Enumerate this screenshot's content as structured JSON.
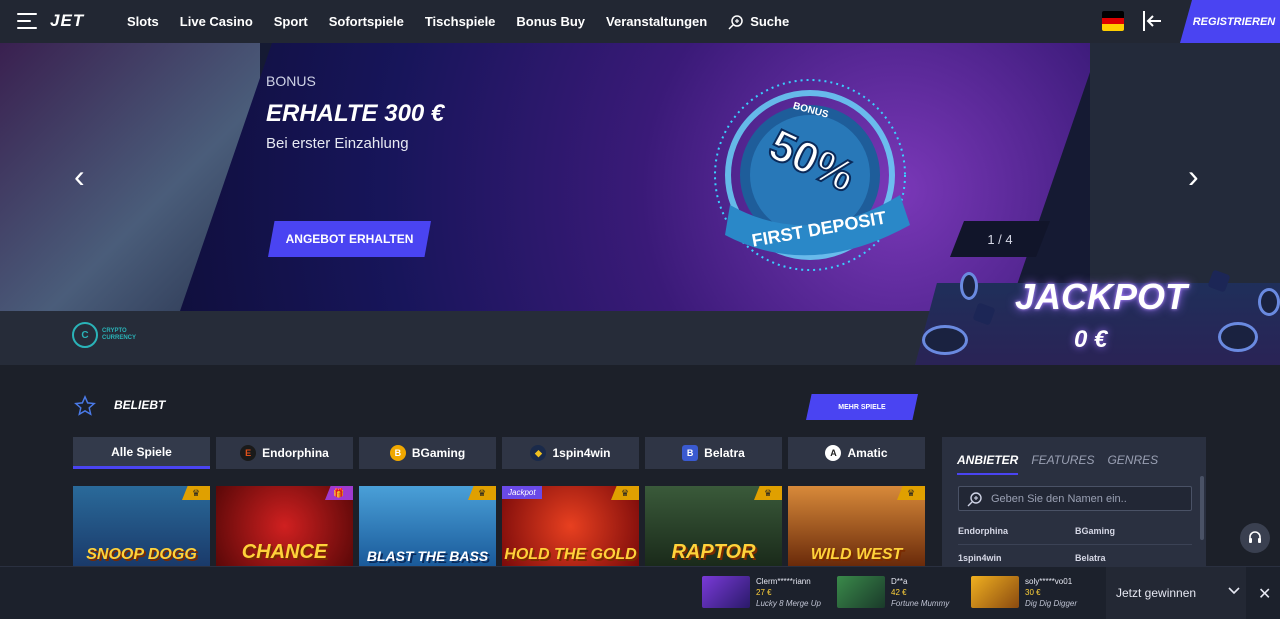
{
  "header": {
    "logo": "JET",
    "nav": [
      "Slots",
      "Live Casino",
      "Sport",
      "Sofortspiele",
      "Tischspiele",
      "Bonus Buy",
      "Veranstaltungen"
    ],
    "search_label": "Suche",
    "register_label": "REGISTRIEREN",
    "language_flag": "de"
  },
  "hero": {
    "tag": "BONUS",
    "title": "ERHALTE 300 €",
    "subtitle": "Bei erster Einzahlung",
    "cta": "ANGEBOT ERHALTEN",
    "badge_top": "BONUS",
    "badge_percent": "50%",
    "badge_bottom": "FIRST DEPOSIT",
    "pager": "1 / 4"
  },
  "payment": {
    "label_line1": "CRYPTO",
    "label_line2": "CURRENCY",
    "icon_letter": "C"
  },
  "jackpot": {
    "title": "JACKPOT",
    "value": "0 €"
  },
  "popular": {
    "title": "BELIEBT",
    "more_button": "MEHR SPIELE",
    "filters": [
      {
        "label": "Alle Spiele",
        "icon": "",
        "color": ""
      },
      {
        "label": "Endorphina",
        "icon": "E",
        "color": "#e0501a"
      },
      {
        "label": "BGaming",
        "icon": "B",
        "color": "#f0a800"
      },
      {
        "label": "1spin4win",
        "icon": "◆",
        "color": "#2a6ad0"
      },
      {
        "label": "Belatra",
        "icon": "B",
        "color": "#3a5ad0"
      },
      {
        "label": "Amatic",
        "icon": "A",
        "color": "#ffffff"
      }
    ],
    "games": [
      {
        "name": "SNOOP DOGG",
        "bg": "#3a7aa8",
        "tag": "♛",
        "jackpot": ""
      },
      {
        "name": "CHANCE",
        "bg": "#8a1010",
        "tag": "🎁",
        "jackpot": ""
      },
      {
        "name": "BLAST THE BASS",
        "bg": "#2a7ab8",
        "tag": "♛",
        "jackpot": ""
      },
      {
        "name": "HOLD THE GOLD",
        "bg": "#b81a1a",
        "tag": "♛",
        "jackpot": "Jackpot"
      },
      {
        "name": "RAPTOR",
        "bg": "#2a4a2a",
        "tag": "♛",
        "jackpot": ""
      },
      {
        "name": "WILD WEST",
        "bg": "#b85a1a",
        "tag": "♛",
        "jackpot": ""
      }
    ]
  },
  "providers_panel": {
    "tabs": [
      "ANBIETER",
      "FEATURES",
      "GENRES"
    ],
    "search_placeholder": "Geben Sie den Namen ein..",
    "providers": [
      [
        "Endorphina",
        "BGaming"
      ],
      [
        "1spin4win",
        "Belatra"
      ]
    ]
  },
  "winners": [
    {
      "user": "Clerm*****riann",
      "amount": "27 €",
      "game": "Lucky 8 Merge Up",
      "color": "#5a2aa8"
    },
    {
      "user": "D**a",
      "amount": "42 €",
      "game": "Fortune Mummy",
      "color": "#2a6a3a"
    },
    {
      "user": "soly*****vo01",
      "amount": "30 €",
      "game": "Dig Dig Digger",
      "color": "#c88a10"
    }
  ],
  "bottom_bar": {
    "cta": "Jetzt gewinnen"
  }
}
